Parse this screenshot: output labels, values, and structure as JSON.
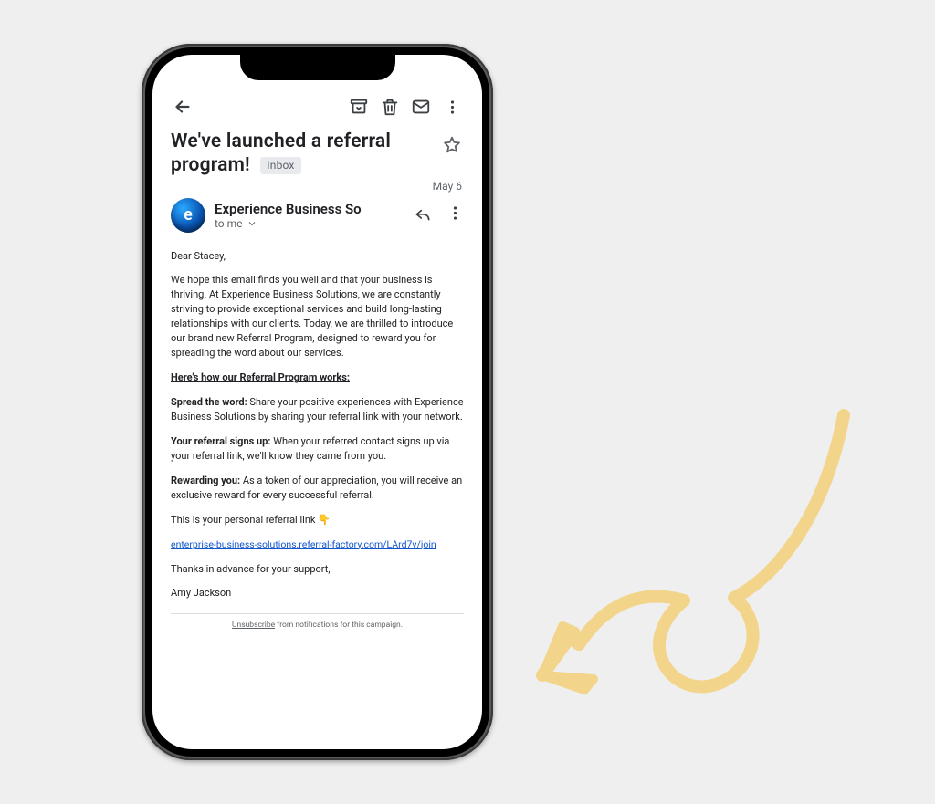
{
  "subject": "We've launched a referral program!",
  "folder": "Inbox",
  "date": "May 6",
  "sender": {
    "name": "Experience Business So",
    "to": "to me",
    "avatar_letter": "e"
  },
  "email": {
    "greeting": "Dear Stacey,",
    "intro": "We hope this email finds you well and that your business is thriving. At Experience Business Solutions, we are constantly striving to provide exceptional services and build long-lasting relationships with our clients. Today, we are thrilled to introduce our brand new Referral Program, designed to reward you for spreading the word about our services.",
    "how_works_heading": "Here's how our Referral Program works:",
    "step1_label": "Spread the word:",
    "step1_text": " Share your positive experiences with Experience Business Solutions by sharing your referral link with your network.",
    "step2_label": "Your referral signs up:",
    "step2_text": " When your referred contact signs up via your referral link, we'll know they came from you.",
    "step3_label": "Rewarding you:",
    "step3_text": " As a token of our appreciation, you will receive an exclusive reward for every successful referral.",
    "personal_link_line": "This is your personal referral link 👇",
    "referral_link": "enterprise-business-solutions.referral-factory.com/LArd7v/join",
    "thanks": "Thanks in advance for your support,",
    "signoff": "Amy Jackson"
  },
  "unsubscribe": {
    "link": "Unsubscribe",
    "tail": " from notifications for this campaign."
  },
  "icons": {
    "back": "back-icon",
    "archive": "archive-icon",
    "delete": "trash-icon",
    "mark_unread": "mail-icon",
    "more": "more-vert-icon",
    "star": "star-outline-icon",
    "reply": "reply-icon"
  },
  "colors": {
    "accent_arrow": "#F4D48B"
  }
}
